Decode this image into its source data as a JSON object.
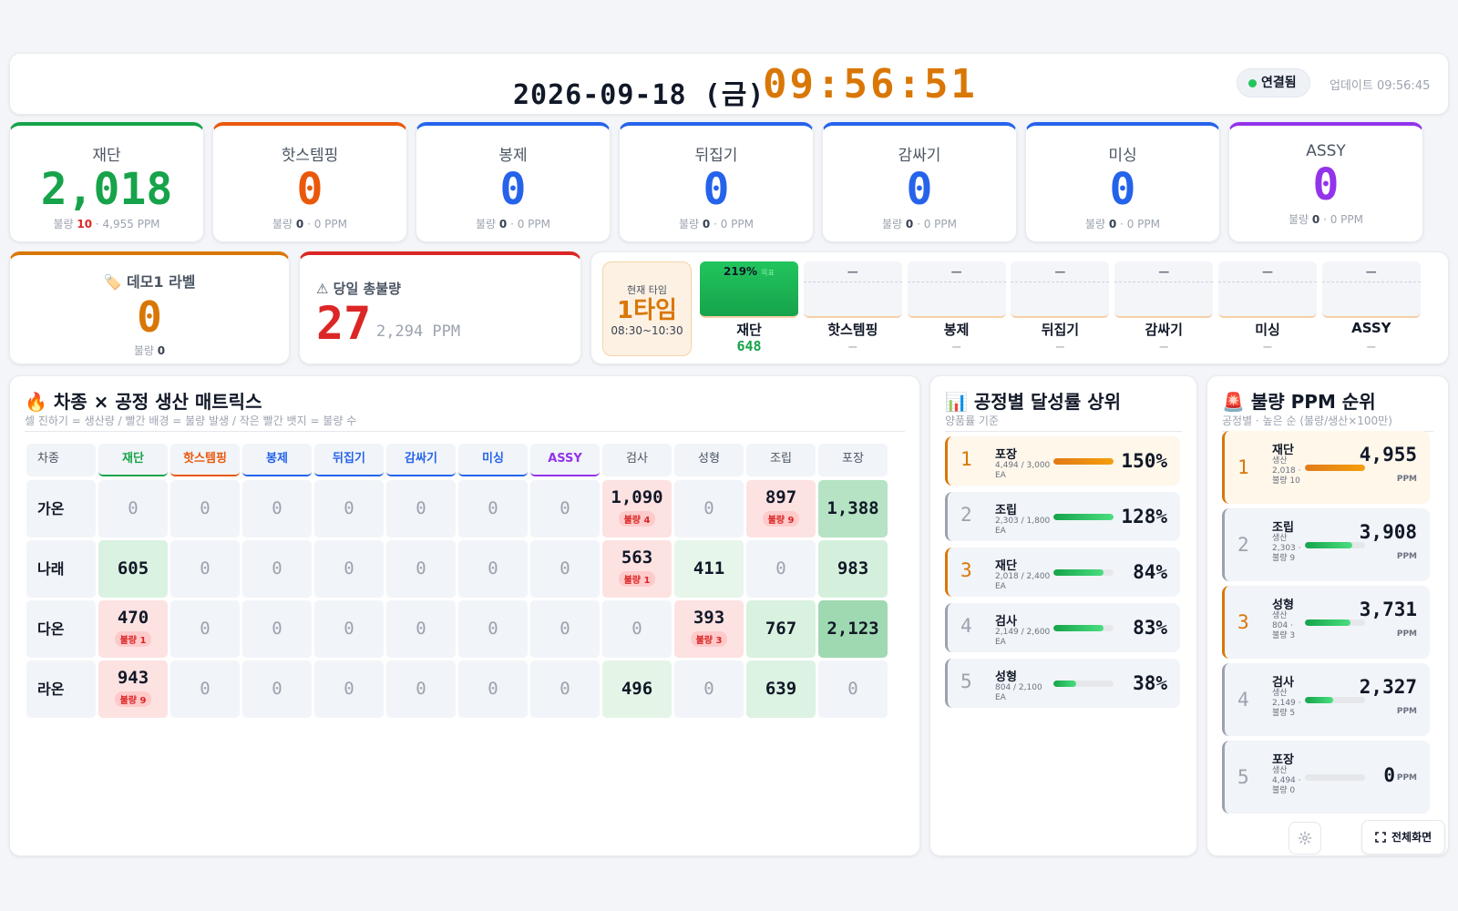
{
  "header": {
    "date": "2026-09-18 (금)",
    "time": "09:56:51",
    "status": "연결됨",
    "updated": "업데이트 09:56:45"
  },
  "colors": {
    "green": "#16a34a",
    "orange": "#ea580c",
    "blue": "#2563eb",
    "purple": "#9333ea",
    "amber": "#d97706",
    "red": "#dc2626"
  },
  "processes": [
    {
      "name": "재단",
      "value": "2,018",
      "defect_label": "불량",
      "defects": "10",
      "ppm": "· 4,955 PPM",
      "color": "#16a34a",
      "defect_color": "red"
    },
    {
      "name": "핫스템핑",
      "value": "0",
      "defect_label": "불량",
      "defects": "0",
      "ppm": "· 0 PPM",
      "color": "#ea580c"
    },
    {
      "name": "봉제",
      "value": "0",
      "defect_label": "불량",
      "defects": "0",
      "ppm": "· 0 PPM",
      "color": "#2563eb"
    },
    {
      "name": "뒤집기",
      "value": "0",
      "defect_label": "불량",
      "defects": "0",
      "ppm": "· 0 PPM",
      "color": "#2563eb"
    },
    {
      "name": "감싸기",
      "value": "0",
      "defect_label": "불량",
      "defects": "0",
      "ppm": "· 0 PPM",
      "color": "#2563eb"
    },
    {
      "name": "미싱",
      "value": "0",
      "defect_label": "불량",
      "defects": "0",
      "ppm": "· 0 PPM",
      "color": "#2563eb"
    },
    {
      "name": "ASSY",
      "value": "0",
      "defect_label": "불량",
      "defects": "0",
      "ppm": "· 0 PPM",
      "color": "#9333ea"
    }
  ],
  "label_card": {
    "icon": "tag-icon",
    "title": "🏷️ 데모1 라벨",
    "value": "0",
    "defect_label": "불량",
    "defects": "0"
  },
  "defect_card": {
    "title": "⚠ 당일 총불량",
    "value": "27",
    "ppm": "2,294 PPM"
  },
  "shift": {
    "label": "현재 타임",
    "name": "1타임",
    "range": "08:30~10:30",
    "processes": [
      {
        "name": "재단",
        "value": "648",
        "pct": "219%",
        "tag": "목표",
        "fill": 1.0
      },
      {
        "name": "핫스템핑",
        "value": "—",
        "pct": "—",
        "fill": 0
      },
      {
        "name": "봉제",
        "value": "—",
        "pct": "—",
        "fill": 0
      },
      {
        "name": "뒤집기",
        "value": "—",
        "pct": "—",
        "fill": 0
      },
      {
        "name": "감싸기",
        "value": "—",
        "pct": "—",
        "fill": 0
      },
      {
        "name": "미싱",
        "value": "—",
        "pct": "—",
        "fill": 0
      },
      {
        "name": "ASSY",
        "value": "—",
        "pct": "—",
        "fill": 0
      }
    ]
  },
  "matrix": {
    "title": "🔥 차종 × 공정 생산 매트릭스",
    "subtitle": "셀 진하기 = 생산량 / 빨간 배경 = 불량 발생 / 작은 빨간 뱃지 = 불량 수",
    "corner": "차종",
    "columns": [
      {
        "name": "재단",
        "color": "#16a34a"
      },
      {
        "name": "핫스템핑",
        "color": "#ea580c"
      },
      {
        "name": "봉제",
        "color": "#2563eb"
      },
      {
        "name": "뒤집기",
        "color": "#2563eb"
      },
      {
        "name": "감싸기",
        "color": "#2563eb"
      },
      {
        "name": "미싱",
        "color": "#2563eb"
      },
      {
        "name": "ASSY",
        "color": "#9333ea"
      },
      {
        "name": "검사",
        "color": ""
      },
      {
        "name": "성형",
        "color": ""
      },
      {
        "name": "조립",
        "color": ""
      },
      {
        "name": "포장",
        "color": ""
      }
    ],
    "rows": [
      {
        "label": "가온",
        "cells": [
          {
            "v": "0"
          },
          {
            "v": "0"
          },
          {
            "v": "0"
          },
          {
            "v": "0"
          },
          {
            "v": "0"
          },
          {
            "v": "0"
          },
          {
            "v": "0"
          },
          {
            "v": "1,090",
            "badge": "불량 4",
            "bg": "#fde2e2"
          },
          {
            "v": "0"
          },
          {
            "v": "897",
            "badge": "불량 9",
            "bg": "#fde2e2"
          },
          {
            "v": "1,388",
            "bg": "#b5e3c4"
          }
        ]
      },
      {
        "label": "나래",
        "cells": [
          {
            "v": "605",
            "bg": "#daf2e1"
          },
          {
            "v": "0"
          },
          {
            "v": "0"
          },
          {
            "v": "0"
          },
          {
            "v": "0"
          },
          {
            "v": "0"
          },
          {
            "v": "0"
          },
          {
            "v": "563",
            "badge": "불량 1",
            "bg": "#fde2e2"
          },
          {
            "v": "411",
            "bg": "#e6f6ea"
          },
          {
            "v": "0"
          },
          {
            "v": "983",
            "bg": "#d4f0dc"
          }
        ]
      },
      {
        "label": "다온",
        "cells": [
          {
            "v": "470",
            "badge": "불량 1",
            "bg": "#fde2e2"
          },
          {
            "v": "0"
          },
          {
            "v": "0"
          },
          {
            "v": "0"
          },
          {
            "v": "0"
          },
          {
            "v": "0"
          },
          {
            "v": "0"
          },
          {
            "v": "0"
          },
          {
            "v": "393",
            "badge": "불량 3",
            "bg": "#fde2e2"
          },
          {
            "v": "767",
            "bg": "#d9f1df"
          },
          {
            "v": "2,123",
            "bg": "#9fd9b1"
          }
        ]
      },
      {
        "label": "라온",
        "cells": [
          {
            "v": "943",
            "badge": "불량 9",
            "bg": "#fde2e2"
          },
          {
            "v": "0"
          },
          {
            "v": "0"
          },
          {
            "v": "0"
          },
          {
            "v": "0"
          },
          {
            "v": "0"
          },
          {
            "v": "0"
          },
          {
            "v": "496",
            "bg": "#e4f5e8"
          },
          {
            "v": "0"
          },
          {
            "v": "639",
            "bg": "#dcf2e2"
          },
          {
            "v": "0"
          }
        ]
      }
    ]
  },
  "achievement": {
    "title": "📊 공정별 달성률 상위",
    "subtitle": "양품률 기준",
    "items": [
      {
        "rank": "1",
        "name": "포장",
        "sub": "4,494 / 3,000 EA",
        "pct": "150%",
        "fill": 1.0,
        "style": "hi"
      },
      {
        "rank": "2",
        "name": "조립",
        "sub": "2,303 / 1,800 EA",
        "pct": "128%",
        "fill": 1.0,
        "style": ""
      },
      {
        "rank": "3",
        "name": "재단",
        "sub": "2,018 / 2,400 EA",
        "pct": "84%",
        "fill": 0.84,
        "style": "mid"
      },
      {
        "rank": "4",
        "name": "검사",
        "sub": "2,149 / 2,600 EA",
        "pct": "83%",
        "fill": 0.83,
        "style": ""
      },
      {
        "rank": "5",
        "name": "성형",
        "sub": "804 / 2,100 EA",
        "pct": "38%",
        "fill": 0.38,
        "style": ""
      }
    ]
  },
  "ppm_rank": {
    "title": "🚨 불량 PPM 순위",
    "subtitle": "공정별 · 높은 순 (불량/생산×100만)",
    "unit": "PPM",
    "items": [
      {
        "rank": "1",
        "name": "재단",
        "sub": "생산 2,018 · 불량 10",
        "ppm": "4,955",
        "fill": 1.0,
        "style": "hi"
      },
      {
        "rank": "2",
        "name": "조립",
        "sub": "생산 2,303 · 불량 9",
        "ppm": "3,908",
        "fill": 0.79,
        "style": ""
      },
      {
        "rank": "3",
        "name": "성형",
        "sub": "생산 804 · 불량 3",
        "ppm": "3,731",
        "fill": 0.75,
        "style": "mid"
      },
      {
        "rank": "4",
        "name": "검사",
        "sub": "생산 2,149 · 불량 5",
        "ppm": "2,327",
        "fill": 0.47,
        "style": ""
      },
      {
        "rank": "5",
        "name": "포장",
        "sub": "생산 4,494 · 불량 0",
        "ppm": "0",
        "fill": 0,
        "style": ""
      }
    ]
  },
  "controls": {
    "settings_icon": "gear-icon",
    "fullscreen_label": "전체화면",
    "fullscreen_icon": "fullscreen-icon"
  }
}
